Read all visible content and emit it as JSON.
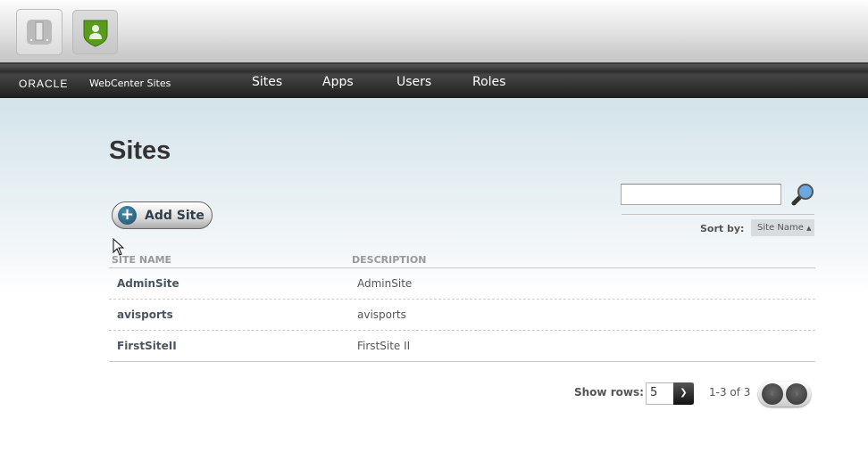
{
  "toolbar": {
    "apps": [
      {
        "name": "admin-app",
        "icon": "panel-icon"
      },
      {
        "name": "user-app",
        "icon": "shield-user-icon"
      }
    ]
  },
  "nav": {
    "logo": "ORACLE",
    "product": "WebCenter Sites",
    "items": [
      "Sites",
      "Apps",
      "Users",
      "Roles"
    ]
  },
  "page": {
    "title": "Sites",
    "add_label": "Add Site",
    "search_value": "",
    "sort_label": "Sort by:",
    "sort_value": "Site Name"
  },
  "table": {
    "headers": [
      "SITE NAME",
      "DESCRIPTION"
    ],
    "rows": [
      {
        "name": "AdminSite",
        "description": "AdminSite"
      },
      {
        "name": "avisports",
        "description": "avisports"
      },
      {
        "name": "FirstSiteII",
        "description": "FirstSite II"
      }
    ]
  },
  "footer": {
    "rows_label": "Show rows:",
    "rows_value": "5",
    "range": "1-3 of 3"
  },
  "colors": {
    "nav_bg": "#2a2a2a",
    "accent": "#1c4e69",
    "shield": "#5a9a1c"
  }
}
